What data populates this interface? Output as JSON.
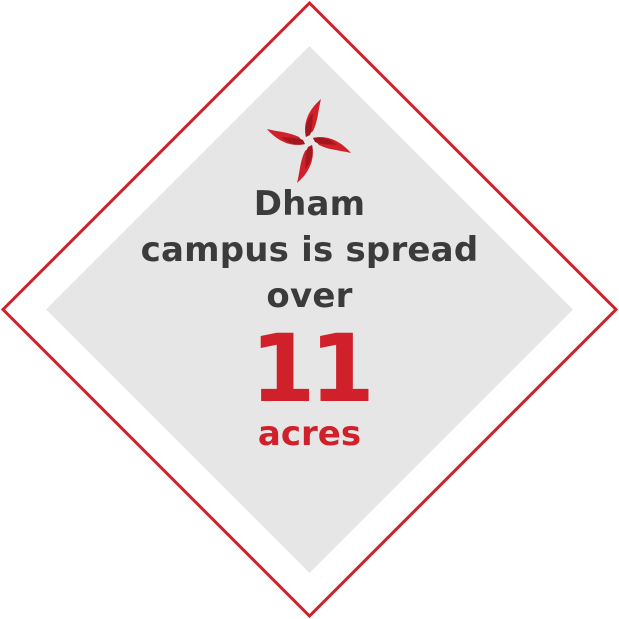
{
  "badge": {
    "line1": "Dham",
    "line2": "campus is spread",
    "line3": "over",
    "number": "11",
    "unit": "acres"
  },
  "colors": {
    "frame_red": "#d0202a",
    "panel_gray": "#e6e6e6",
    "text_dark": "#3b3b3b",
    "accent_red": "#d0202a",
    "logo_dark_red": "#a3161d"
  },
  "icons": {
    "logo": "pinwheel-swastika-icon"
  }
}
